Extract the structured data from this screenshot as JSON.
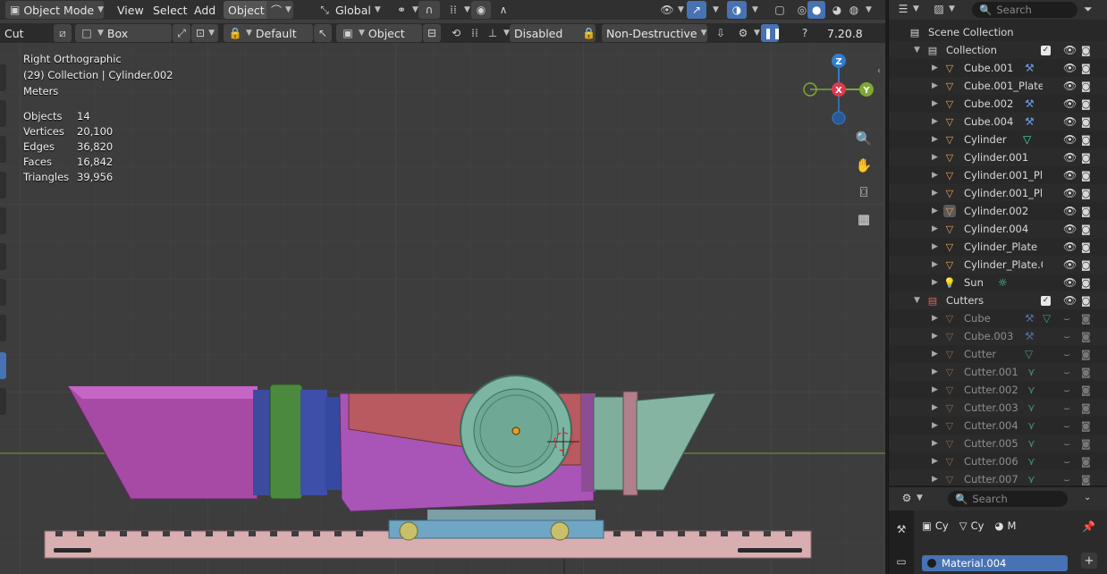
{
  "header": {
    "mode_label": "Object Mode",
    "menu": [
      "View",
      "Select",
      "Add",
      "Object"
    ],
    "active_menu": "Object",
    "orientation_label": "Global"
  },
  "toolbar": {
    "tool_label": "Cut",
    "shape_label": "Box",
    "mode_label": "Default",
    "target_label": "Object",
    "bevel_label": "Disabled",
    "method_label": "Non-Destructive",
    "version": "7.20.8"
  },
  "viewport": {
    "view_name": "Right Orthographic",
    "context": "(29) Collection | Cylinder.002",
    "units": "Meters",
    "stats": [
      {
        "label": "Objects",
        "value": "14"
      },
      {
        "label": "Vertices",
        "value": "20,100"
      },
      {
        "label": "Edges",
        "value": "36,820"
      },
      {
        "label": "Faces",
        "value": "16,842"
      },
      {
        "label": "Triangles",
        "value": "39,956"
      }
    ],
    "gizmo": {
      "z": "Z",
      "x": "X",
      "y": "Y"
    }
  },
  "outliner": {
    "search_placeholder": "Search",
    "scene_collection": "Scene Collection",
    "collections": [
      {
        "name": "Collection",
        "color": "#cfcfcf",
        "items": [
          {
            "name": "Cube.001",
            "modifier": "wrench"
          },
          {
            "name": "Cube.001_Plate",
            "modifier": ""
          },
          {
            "name": "Cube.002",
            "modifier": "wrench"
          },
          {
            "name": "Cube.004",
            "modifier": "wrench"
          },
          {
            "name": "Cylinder",
            "modifier": "mesh"
          },
          {
            "name": "Cylinder.001",
            "modifier": ""
          },
          {
            "name": "Cylinder.001_Pla",
            "modifier": ""
          },
          {
            "name": "Cylinder.001_Pla",
            "modifier": ""
          },
          {
            "name": "Cylinder.002",
            "modifier": "",
            "active": true
          },
          {
            "name": "Cylinder.004",
            "modifier": ""
          },
          {
            "name": "Cylinder_Plate",
            "modifier": ""
          },
          {
            "name": "Cylinder_Plate.0(",
            "modifier": ""
          },
          {
            "name": "Sun",
            "modifier": "sun",
            "type": "light"
          }
        ]
      },
      {
        "name": "Cutters",
        "color": "#e06060",
        "items": [
          {
            "name": "Cube",
            "modifier": "wrench-mesh"
          },
          {
            "name": "Cube.003",
            "modifier": "wrench"
          },
          {
            "name": "Cutter",
            "modifier": "mesh"
          },
          {
            "name": "Cutter.001",
            "modifier": "vertex"
          },
          {
            "name": "Cutter.002",
            "modifier": "vertex"
          },
          {
            "name": "Cutter.003",
            "modifier": "vertex"
          },
          {
            "name": "Cutter.004",
            "modifier": "vertex"
          },
          {
            "name": "Cutter.005",
            "modifier": "vertex"
          },
          {
            "name": "Cutter.006",
            "modifier": "vertex"
          },
          {
            "name": "Cutter.007",
            "modifier": "vertex"
          }
        ]
      }
    ]
  },
  "properties": {
    "search_placeholder": "Search",
    "breadcrumb": [
      "Cy",
      "Cy",
      "M"
    ],
    "material_slot": "Material.004"
  },
  "colors": {
    "accent": "#4772b3",
    "object_icon": "#e8a35a",
    "wrench": "#6d9de8",
    "mesh_data": "#4ee0a0",
    "x_axis": "#e0394d",
    "y_axis": "#7ea734",
    "z_axis": "#2f7dd1"
  }
}
